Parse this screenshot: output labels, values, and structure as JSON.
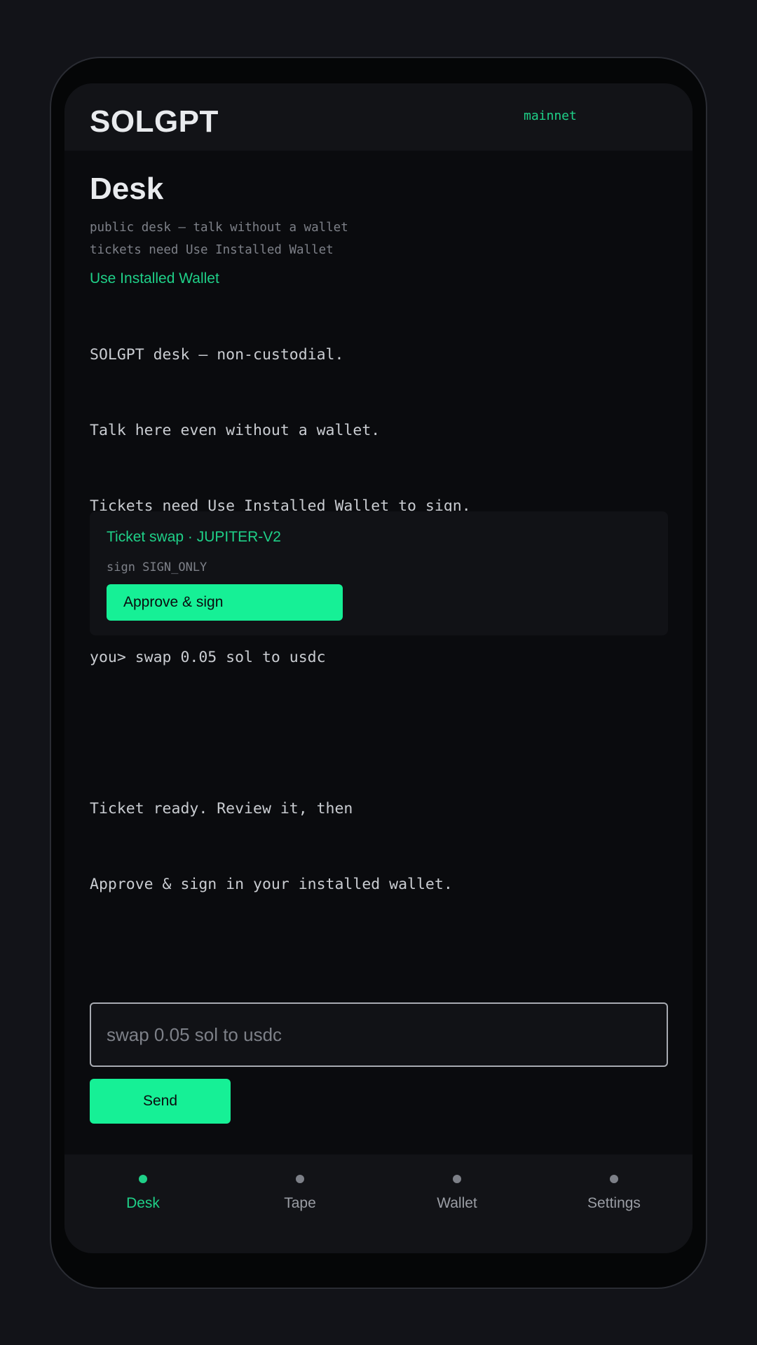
{
  "header": {
    "brand": "SOLGPT",
    "network": "mainnet"
  },
  "page": {
    "title": "Desk",
    "subtitle_lines": [
      "public desk — talk without a wallet",
      "tickets need Use Installed Wallet"
    ],
    "wallet_link": "Use Installed Wallet"
  },
  "chat_log": [
    "SOLGPT desk — non-custodial.",
    "Talk here even without a wallet.",
    "Tickets need Use Installed Wallet to sign.",
    "",
    "you> swap 0.05 sol to usdc",
    "",
    "Ticket ready. Review it, then",
    "Approve & sign in your installed wallet."
  ],
  "ticket": {
    "title": "Ticket swap · JUPITER-V2",
    "sign_mode": "sign SIGN_ONLY",
    "approve_label": "Approve & sign"
  },
  "composer": {
    "value": "",
    "placeholder": "swap 0.05 sol to usdc",
    "send_label": "Send"
  },
  "nav": {
    "items": [
      {
        "label": "Desk",
        "icon": "dot-icon",
        "active": true
      },
      {
        "label": "Tape",
        "icon": "dot-icon",
        "active": false
      },
      {
        "label": "Wallet",
        "icon": "dot-icon",
        "active": false
      },
      {
        "label": "Settings",
        "icon": "dot-icon",
        "active": false
      }
    ]
  },
  "colors": {
    "accent": "#16f096",
    "accent_text": "#1fd088",
    "background": "#0a0b0e",
    "panel": "#121317",
    "muted": "#7d8088"
  }
}
